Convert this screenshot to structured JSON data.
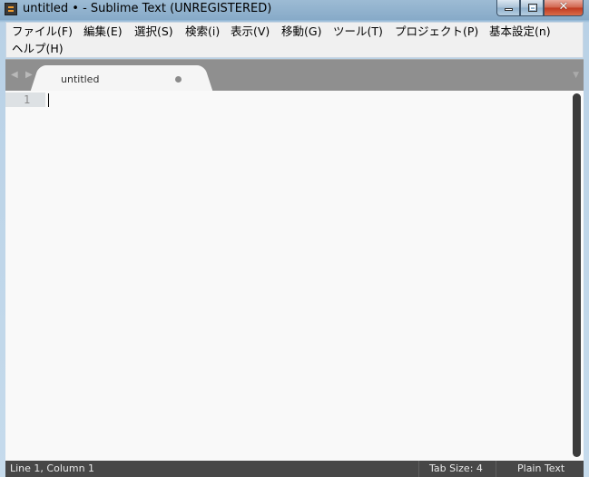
{
  "window": {
    "title": "untitled • - Sublime Text (UNREGISTERED)",
    "minimize_icon": "minimize-icon",
    "maximize_icon": "maximize-icon",
    "close_icon": "close-icon",
    "close_glyph": "✕"
  },
  "menu": {
    "items": [
      {
        "label": "ファイル(F)"
      },
      {
        "label": "編集(E)"
      },
      {
        "label": "選択(S)"
      },
      {
        "label": "検索(i)"
      },
      {
        "label": "表示(V)"
      },
      {
        "label": "移動(G)"
      },
      {
        "label": "ツール(T)"
      },
      {
        "label": "プロジェクト(P)"
      },
      {
        "label": "基本設定(n)"
      },
      {
        "label": "ヘルプ(H)"
      }
    ]
  },
  "tabs": {
    "prev_arrow": "◀",
    "next_arrow": "▶",
    "dropdown_arrow": "▼",
    "items": [
      {
        "title": "untitled",
        "modified": true
      }
    ]
  },
  "editor": {
    "lines": [
      {
        "number": "1",
        "text": ""
      }
    ]
  },
  "status": {
    "position": "Line 1, Column 1",
    "tab_size": "Tab Size: 4",
    "syntax": "Plain Text"
  },
  "colors": {
    "accent": "#f19b2b",
    "editor_bg": "#f9f9f9",
    "status_bg": "#474747"
  }
}
